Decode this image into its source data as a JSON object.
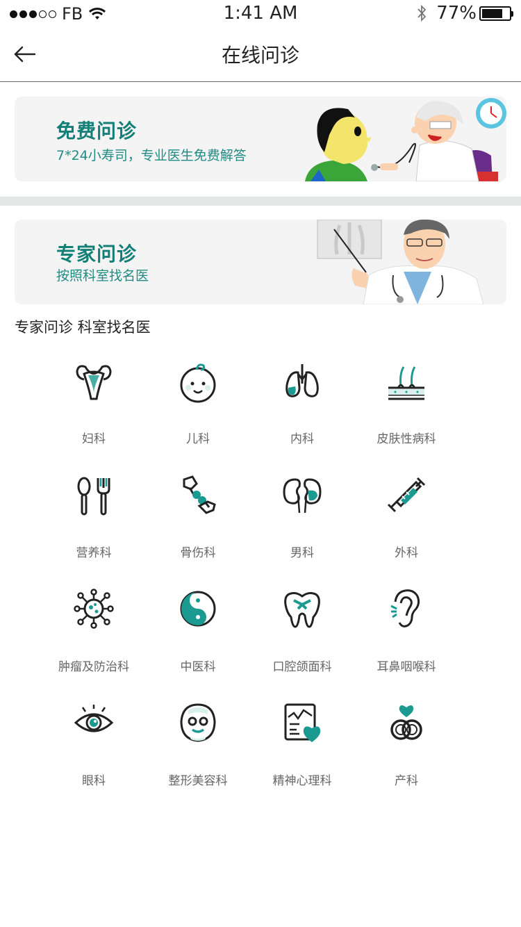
{
  "status_bar": {
    "carrier": "FB",
    "time": "1:41 AM",
    "battery": "77%",
    "battery_level": 0.77,
    "signal_bars": 3
  },
  "nav": {
    "title": "在线问诊",
    "back_icon": "arrow-left-icon"
  },
  "banners": {
    "free": {
      "title": "免费问诊",
      "subtitle": "7*24小寿司，专业医生免费解答"
    },
    "expert": {
      "title": "专家问诊",
      "subtitle": "按照科室找名医"
    }
  },
  "section": {
    "title": "专家问诊  科室找名医"
  },
  "colors": {
    "accent": "#1e8c82",
    "teal": "#1a9a90",
    "icon_stroke": "#222222"
  },
  "departments": [
    {
      "label": "妇科",
      "icon": "uterus-icon"
    },
    {
      "label": "儿科",
      "icon": "baby-face-icon"
    },
    {
      "label": "内科",
      "icon": "lungs-icon"
    },
    {
      "label": "皮肤性病科",
      "icon": "skin-hair-icon"
    },
    {
      "label": "营养科",
      "icon": "spoon-fork-icon"
    },
    {
      "label": "骨伤科",
      "icon": "bone-joint-icon"
    },
    {
      "label": "男科",
      "icon": "kidneys-icon"
    },
    {
      "label": "外科",
      "icon": "syringe-icon"
    },
    {
      "label": "肿瘤及防治科",
      "icon": "virus-cell-icon"
    },
    {
      "label": "中医科",
      "icon": "yin-yang-icon"
    },
    {
      "label": "口腔颌面科",
      "icon": "tooth-icon"
    },
    {
      "label": "耳鼻咽喉科",
      "icon": "ear-icon"
    },
    {
      "label": "眼科",
      "icon": "eye-icon"
    },
    {
      "label": "整形美容科",
      "icon": "face-mask-icon"
    },
    {
      "label": "精神心理科",
      "icon": "chart-heart-icon"
    },
    {
      "label": "产科",
      "icon": "rings-heart-icon"
    }
  ]
}
